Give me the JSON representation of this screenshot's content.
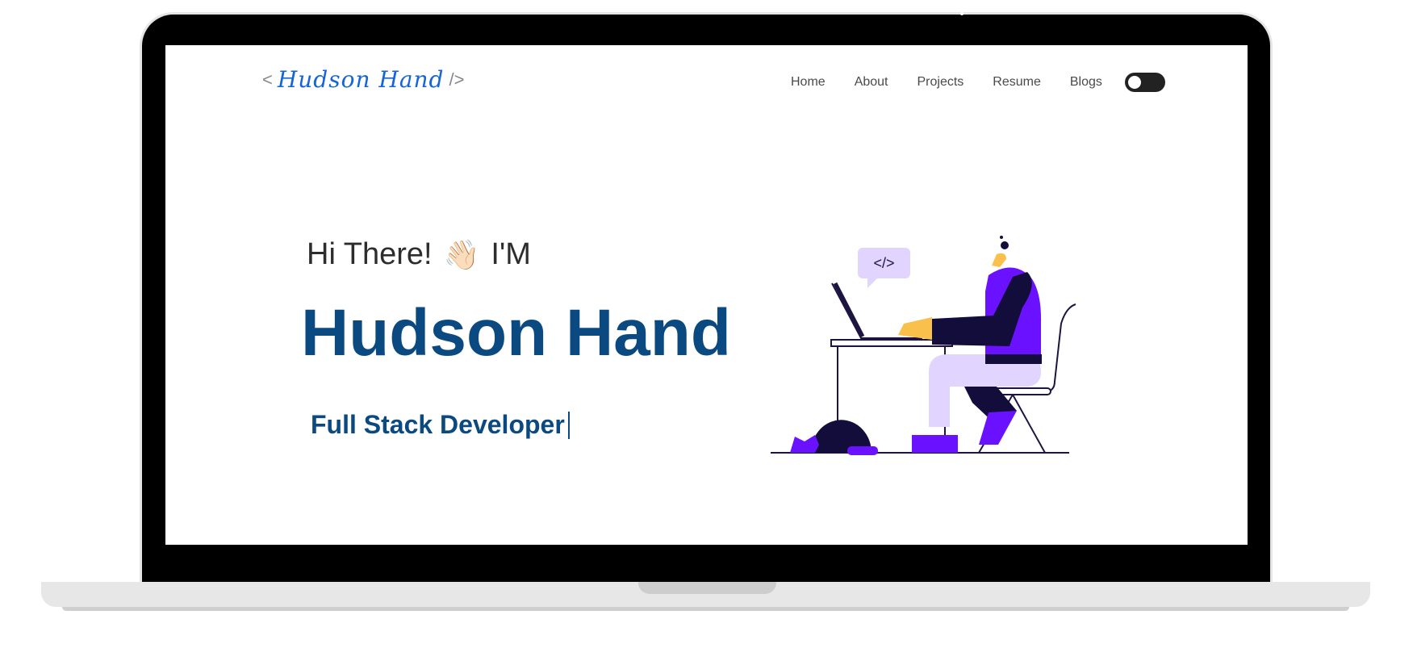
{
  "brand": {
    "open_bracket": "<",
    "name": "Hudson Hand",
    "close_bracket": "/>",
    "accent_color": "#1565d8"
  },
  "nav": {
    "items": [
      {
        "label": "Home"
      },
      {
        "label": "About"
      },
      {
        "label": "Projects"
      },
      {
        "label": "Resume"
      },
      {
        "label": "Blogs"
      }
    ],
    "theme_toggle": {
      "state": "dark-off"
    }
  },
  "hero": {
    "greeting_start": "Hi There!",
    "wave_icon": "waving-hand-icon",
    "greeting_end": "I'M",
    "name": "Hudson Hand",
    "role": "Full Stack Developer",
    "name_color": "#0b4a80"
  },
  "illustration": {
    "code_bubble": "</>",
    "accent_purple": "#6a11ff",
    "light_purple": "#e1d4ff"
  }
}
